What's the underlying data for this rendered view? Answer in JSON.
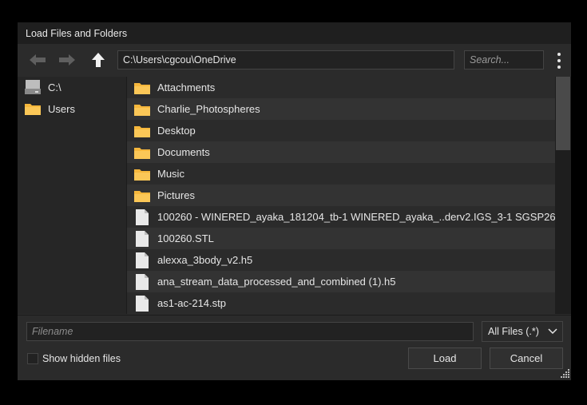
{
  "window": {
    "title": "Load Files and Folders"
  },
  "toolbar": {
    "path": "C:\\Users\\cgcou\\OneDrive",
    "search_placeholder": "Search..."
  },
  "sidebar": {
    "items": [
      {
        "label": "C:\\",
        "icon": "drive-icon"
      },
      {
        "label": "Users",
        "icon": "folder-icon"
      }
    ]
  },
  "files": [
    {
      "name": "Attachments",
      "type": "folder"
    },
    {
      "name": "Charlie_Photospheres",
      "type": "folder"
    },
    {
      "name": "Desktop",
      "type": "folder"
    },
    {
      "name": "Documents",
      "type": "folder"
    },
    {
      "name": "Music",
      "type": "folder"
    },
    {
      "name": "Pictures",
      "type": "folder"
    },
    {
      "name": "100260 - WINERED_ayaka_181204_tb-1 WINERED_ayaka_..derv2.IGS_3-1 SGSP26",
      "type": "file"
    },
    {
      "name": "100260.STL",
      "type": "file"
    },
    {
      "name": "alexxa_3body_v2.h5",
      "type": "file"
    },
    {
      "name": "ana_stream_data_processed_and_combined (1).h5",
      "type": "file"
    },
    {
      "name": "as1-ac-214.stp",
      "type": "file"
    }
  ],
  "footer": {
    "filename_placeholder": "Filename",
    "filter_value": "All Files (.*)",
    "show_hidden_label": "Show hidden files",
    "load_label": "Load",
    "cancel_label": "Cancel"
  },
  "colors": {
    "folder": "#f6b73c",
    "background": "#2b2b2b",
    "titlebar": "#1f1f1f"
  }
}
